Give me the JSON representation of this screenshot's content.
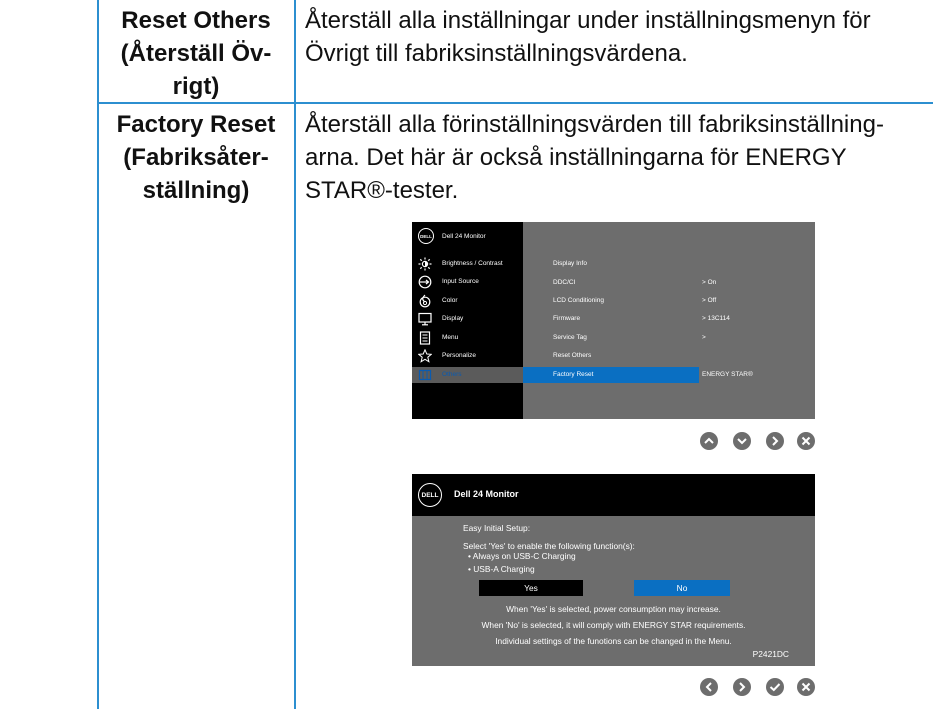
{
  "table": {
    "rows": [
      {
        "label": [
          "Reset Others",
          "(Återställ Öv-",
          "rigt)"
        ],
        "description": [
          "Återställ alla inställningar under inställningsmenyn för",
          "Övrigt till fabriksinställningsvärdena."
        ]
      },
      {
        "label": [
          "Factory Reset",
          "(Fabriksåter-",
          "ställning)"
        ],
        "description": [
          "Återställ alla förinställningsvärden till fabriksinställning-",
          "arna. Det här är också inställningarna för ENERGY",
          "STAR®-tester."
        ]
      }
    ]
  },
  "osd_menu": {
    "logo": "DELL",
    "title": "Dell 24 Monitor",
    "menu_items": [
      {
        "label": "Brightness / Contrast",
        "icon": "brightness-icon"
      },
      {
        "label": "Input Source",
        "icon": "input-source-icon"
      },
      {
        "label": "Color",
        "icon": "color-icon"
      },
      {
        "label": "Display",
        "icon": "display-icon"
      },
      {
        "label": "Menu",
        "icon": "menu-icon"
      },
      {
        "label": "Personalize",
        "icon": "star-icon"
      },
      {
        "label": "Others",
        "icon": "others-icon",
        "active": true
      }
    ],
    "submenu": [
      {
        "label": "Display Info",
        "value": ""
      },
      {
        "label": "DDC/CI",
        "value": "> On"
      },
      {
        "label": "LCD Conditioning",
        "value": "> Off"
      },
      {
        "label": "Firmware",
        "value": "> 13C114"
      },
      {
        "label": "Service Tag",
        "value": ">"
      },
      {
        "label": "Reset Others",
        "value": ""
      },
      {
        "label": "Factory Reset",
        "value": "ENERGY STAR®",
        "selected": true
      }
    ],
    "nav_buttons": [
      "up-icon",
      "down-icon",
      "right-icon",
      "close-icon"
    ]
  },
  "dialog": {
    "logo": "DELL",
    "title": "Dell 24 Monitor",
    "heading": "Easy Initial Setup:",
    "prompt": "Select 'Yes' to enable the following function(s):",
    "bullets": [
      "• Always on USB-C Charging",
      "• USB-A Charging"
    ],
    "yes_label": "Yes",
    "no_label": "No",
    "notes": [
      "When 'Yes' is selected, power consumption may increase.",
      "When 'No' is selected, it will comply with ENERGY STAR requirements.",
      "Individual settings of the funotions can be changed in the Menu."
    ],
    "model": "P2421DC",
    "nav_buttons": [
      "left-icon",
      "right-icon",
      "check-icon",
      "close-icon"
    ]
  },
  "colors": {
    "table_border": "#2c8fd0",
    "osd_background": "#6d6d6d",
    "osd_highlight": "#0a6fc2",
    "nav_button": "#6d6d6d"
  }
}
